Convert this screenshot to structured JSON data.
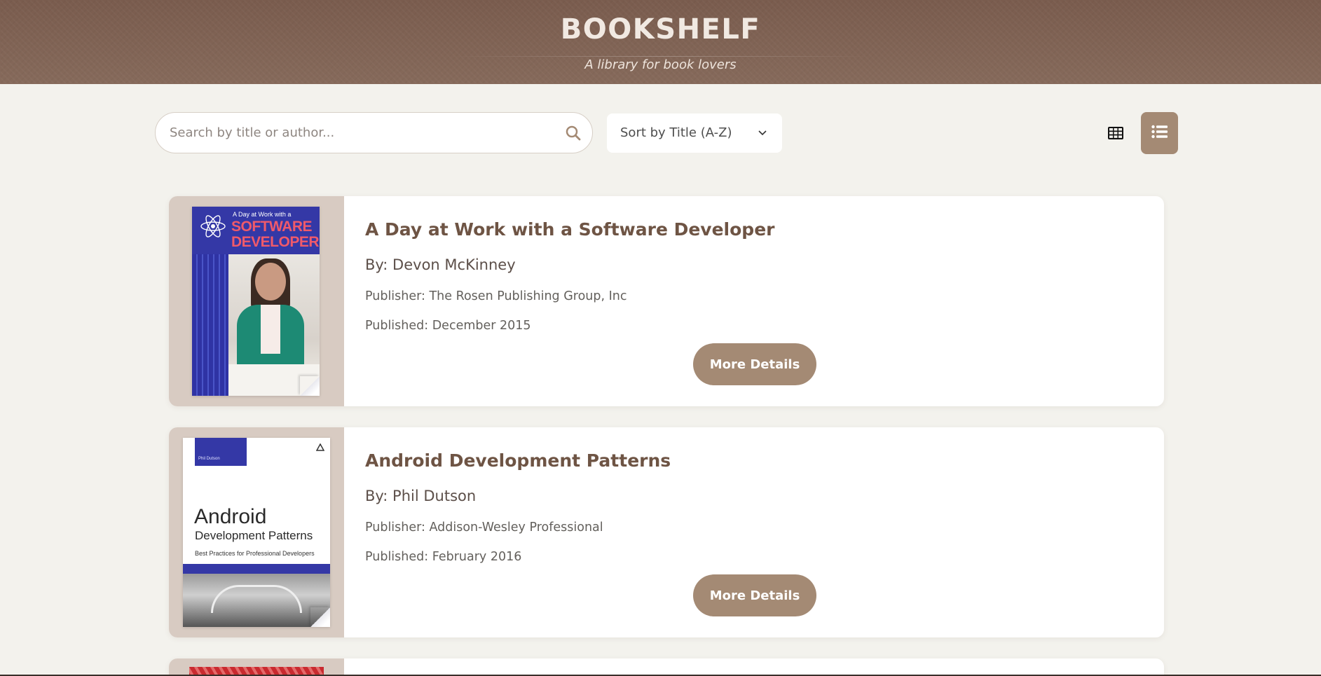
{
  "header": {
    "title": "BOOKSHELF",
    "subtitle": "A library for book lovers"
  },
  "controls": {
    "search_placeholder": "Search by title or author...",
    "sort_selected": "Sort by Title (A-Z)",
    "grid_view_icon": "grid-icon",
    "list_view_icon": "list-icon",
    "active_view": "list"
  },
  "books": [
    {
      "title": "A Day at Work with a Software Developer",
      "author": "By: Devon McKinney",
      "publisher": "Publisher: The Rosen Publishing Group, Inc",
      "published": "Published: December 2015",
      "button": "More Details",
      "cover_text": {
        "line1": "A Day at Work with a",
        "line2": "SOFTWARE",
        "line3": "DEVELOPER"
      }
    },
    {
      "title": "Android Development Patterns",
      "author": "By: Phil Dutson",
      "publisher": "Publisher: Addison-Wesley Professional",
      "published": "Published: February 2016",
      "button": "More Details",
      "cover_text": {
        "author": "Phil Dutson",
        "line1": "Android",
        "line2": "Development Patterns",
        "line3": "Best Practices for Professional Developers"
      }
    }
  ],
  "colors": {
    "header_bg": "#7a5c4e",
    "page_bg": "#f3f2ed",
    "accent": "#a48a74",
    "cover_area_bg": "#d8cbc2",
    "title_text": "#6e5444"
  }
}
